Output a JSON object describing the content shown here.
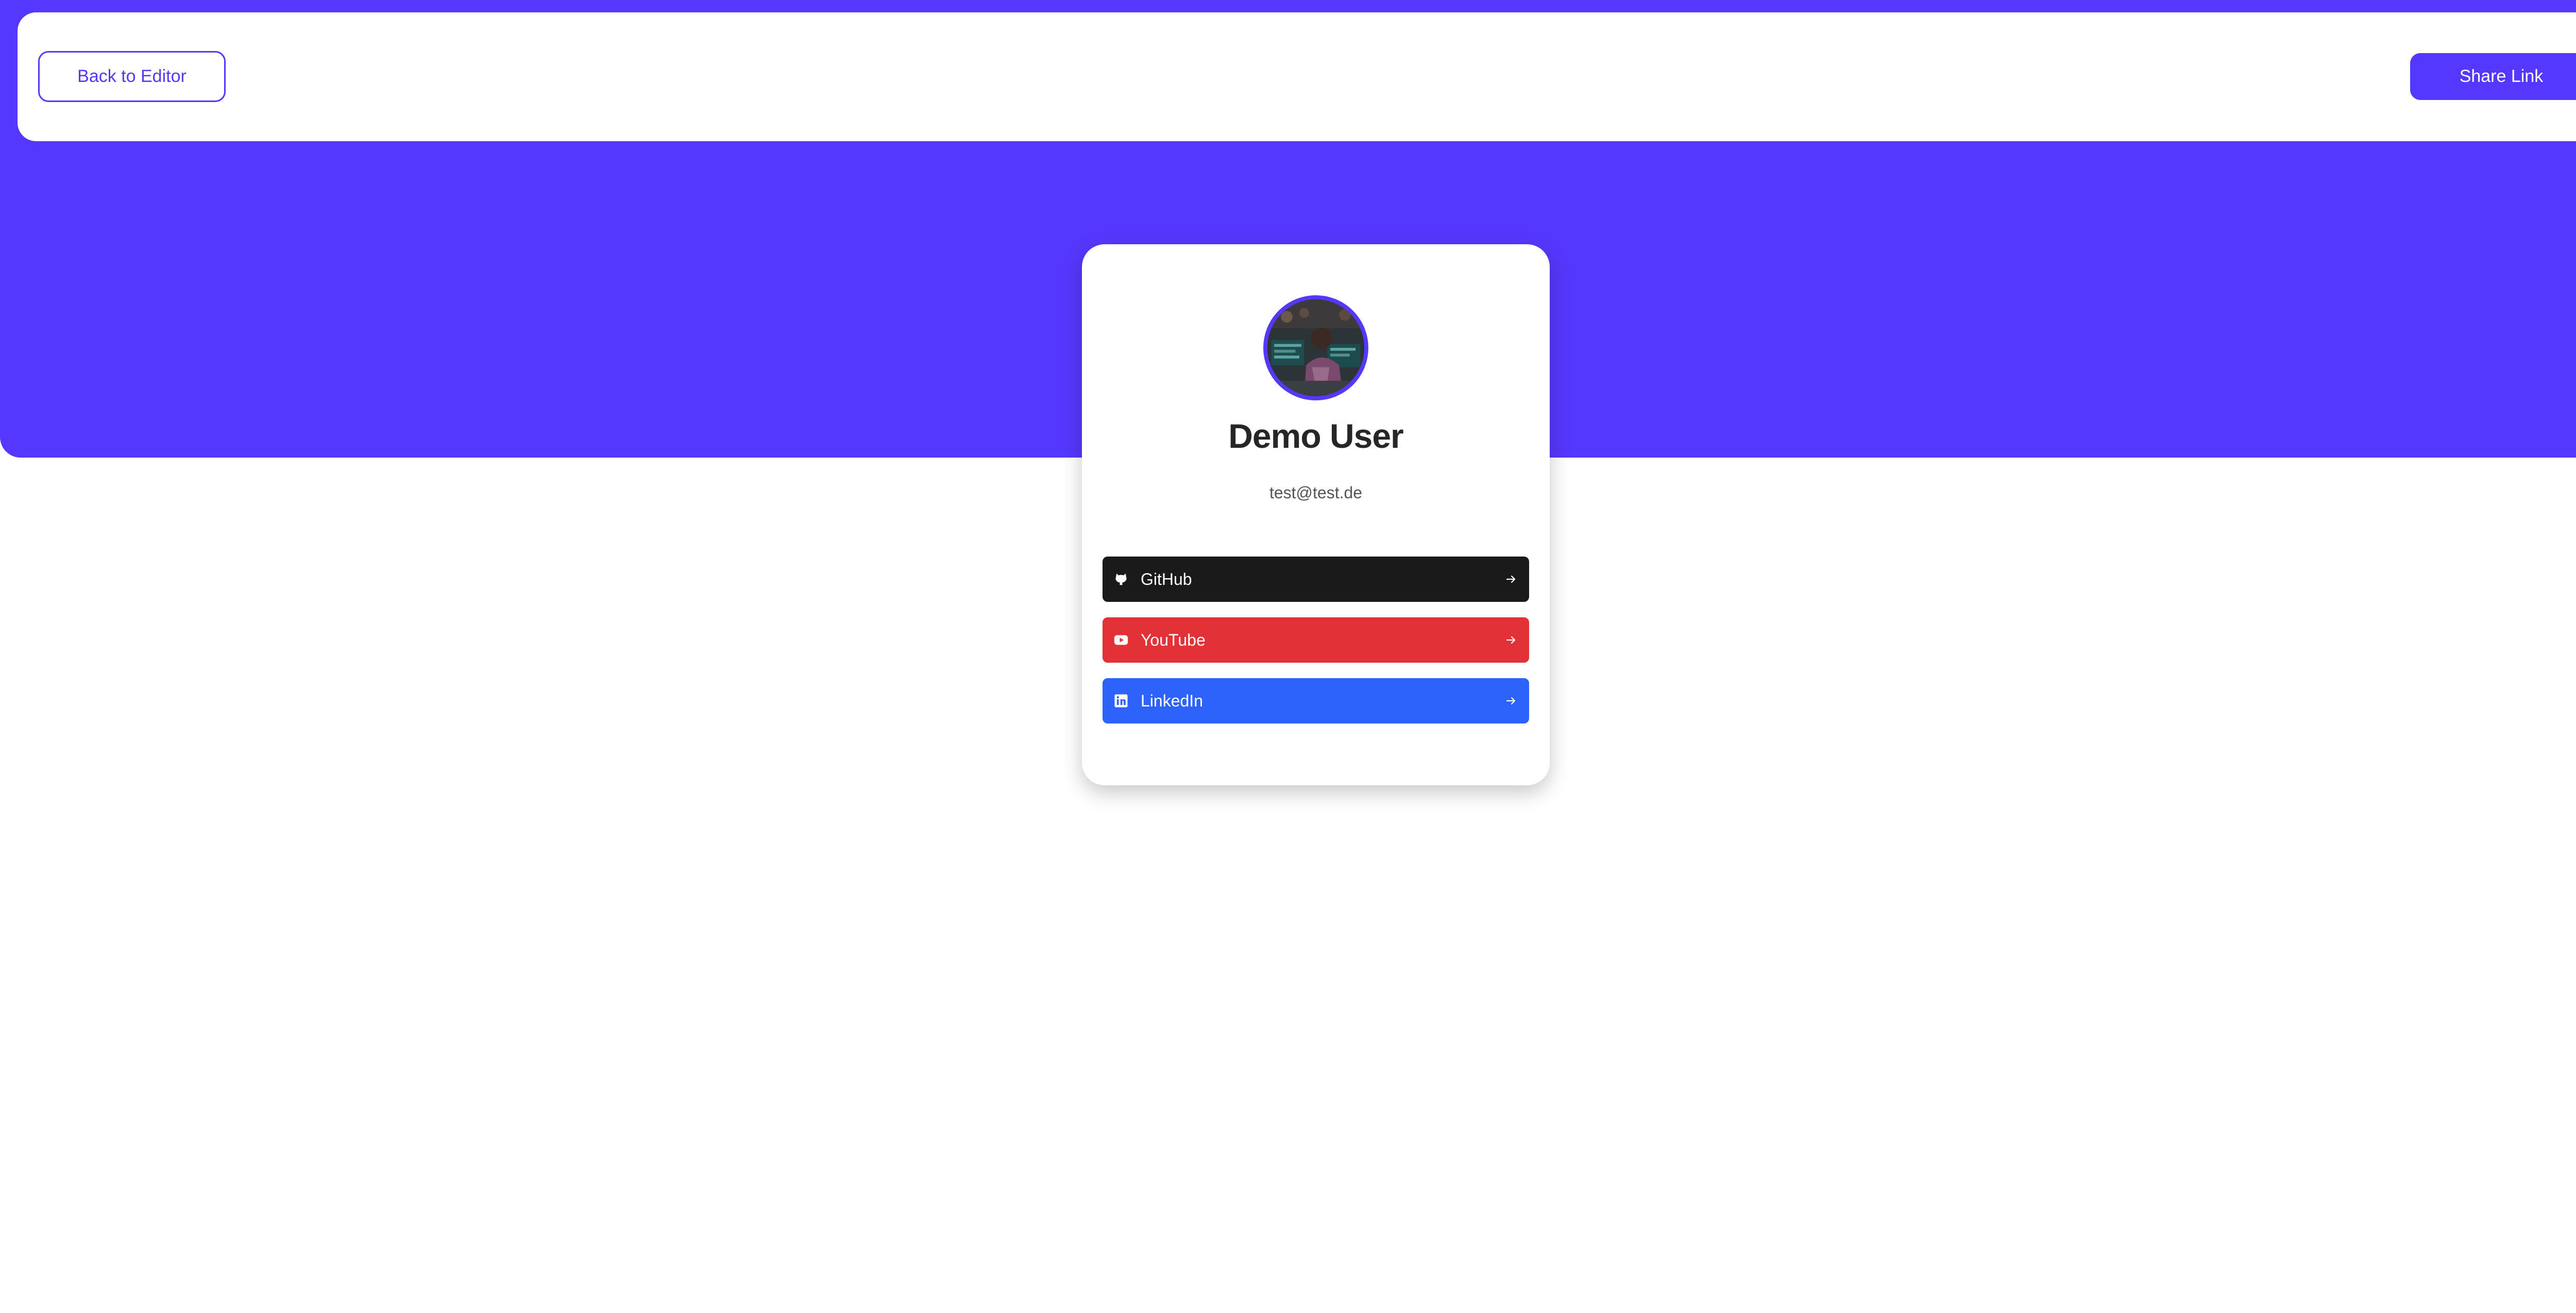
{
  "colors": {
    "brand": "#5538fd",
    "github": "#1a1a1a",
    "youtube": "#e23137",
    "linkedin": "#2d62fb"
  },
  "toolbar": {
    "back_label": "Back to Editor",
    "share_label": "Share Link"
  },
  "profile": {
    "name": "Demo User",
    "email": "test@test.de",
    "avatar_icon": "profile-photo"
  },
  "links": [
    {
      "label": "GitHub",
      "icon": "github-icon",
      "arrow": "arrow-right-icon"
    },
    {
      "label": "YouTube",
      "icon": "youtube-icon",
      "arrow": "arrow-right-icon"
    },
    {
      "label": "LinkedIn",
      "icon": "linkedin-icon",
      "arrow": "arrow-right-icon"
    }
  ]
}
